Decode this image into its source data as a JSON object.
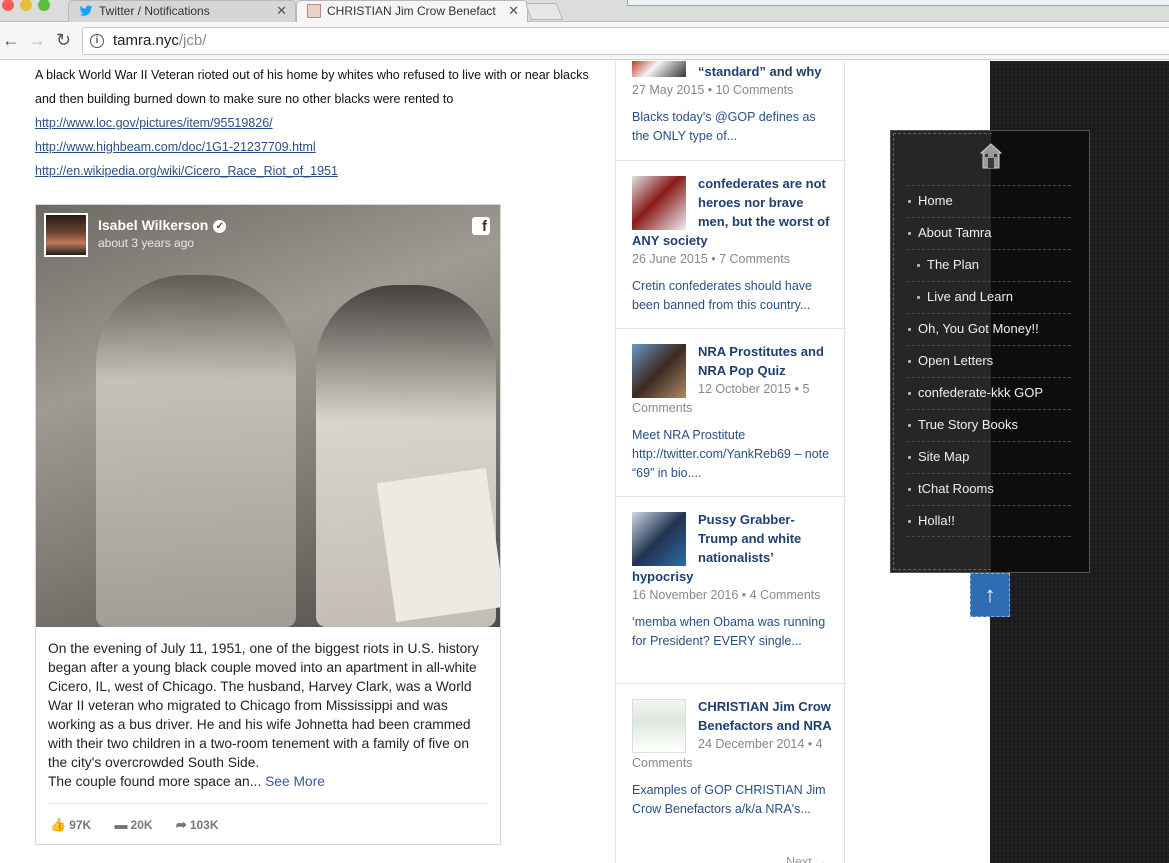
{
  "browser": {
    "tabs": [
      {
        "title": "Twitter / Notifications"
      },
      {
        "title": "CHRISTIAN Jim Crow Benefact"
      }
    ],
    "url_host": "tamra.nyc",
    "url_path": "/jcb/"
  },
  "article": {
    "intro": "A black World War II Veteran rioted out of his home by whites who refused to live with or near blacks and then building burned down to make sure no other blacks were rented to",
    "links": [
      "http://www.loc.gov/pictures/item/95519826/",
      "http://www.highbeam.com/doc/1G1-21237709.html",
      "http://en.wikipedia.org/wiki/Cicero_Race_Riot_of_1951"
    ]
  },
  "fb_post": {
    "author": "Isabel Wilkerson",
    "time": "about 3 years ago",
    "text": "On the evening of July 11, 1951, one of the biggest riots in U.S. history began after a young black couple moved into an apartment in all-white Cicero, IL, west of Chicago. The husband, Harvey Clark, was a World War II veteran who migrated to Chicago from Mississippi and was working as a bus driver. He and his wife Johnetta had been crammed with their two children in a two-room tenement with a family of five on the city's overcrowded South Side.",
    "text2": "The couple found more space an... ",
    "see_more": "See More",
    "likes": "97K",
    "comments": "20K",
    "shares": "103K"
  },
  "sidebar_posts": [
    {
      "title": "“standard” and why",
      "meta": "27 May 2015 • 10 Comments",
      "excerpt": "Blacks today's @GOP defines as the ONLY type of..."
    },
    {
      "title": "confederates are not heroes nor brave men, but the worst of ANY society",
      "meta": "26 June 2015 • 7 Comments",
      "excerpt": "Cretin confederates should have been banned from this country..."
    },
    {
      "title": "NRA Prostitutes and NRA Pop Quiz",
      "meta": "12 October 2015 • 5 Comments",
      "excerpt": "Meet NRA Prostitute http://twitter.com/YankReb69 – note “69” in bio...."
    },
    {
      "title": "Pussy Grabber-Trump and white nationalists’ hypocrisy",
      "meta": "16 November 2016 • 4 Comments",
      "excerpt": "‘memba when Obama was running for President? EVERY single..."
    },
    {
      "title": "CHRISTIAN Jim Crow Benefactors and NRA",
      "meta": "24 December 2014 • 4 Comments",
      "excerpt": "Examples of GOP CHRISTIAN Jim Crow Benefactors a/k/a NRA's..."
    }
  ],
  "next_label": "Next →",
  "menu": {
    "items": [
      {
        "label": "Home",
        "sub": false
      },
      {
        "label": "About Tamra",
        "sub": false
      },
      {
        "label": "The Plan",
        "sub": true
      },
      {
        "label": "Live and Learn",
        "sub": true
      },
      {
        "label": "Oh, You Got Money!!",
        "sub": false
      },
      {
        "label": "Open Letters",
        "sub": false
      },
      {
        "label": "confederate-kkk GOP",
        "sub": false
      },
      {
        "label": "True Story Books",
        "sub": false
      },
      {
        "label": "Site Map",
        "sub": false
      },
      {
        "label": "tChat Rooms",
        "sub": false
      },
      {
        "label": "Holla!!",
        "sub": false
      }
    ],
    "up_arrow": "↑"
  },
  "colors": {
    "link": "#2b4f84",
    "post_title": "#1f3f6e",
    "menu_bg": "#262626",
    "up_button": "#2e6db4"
  }
}
